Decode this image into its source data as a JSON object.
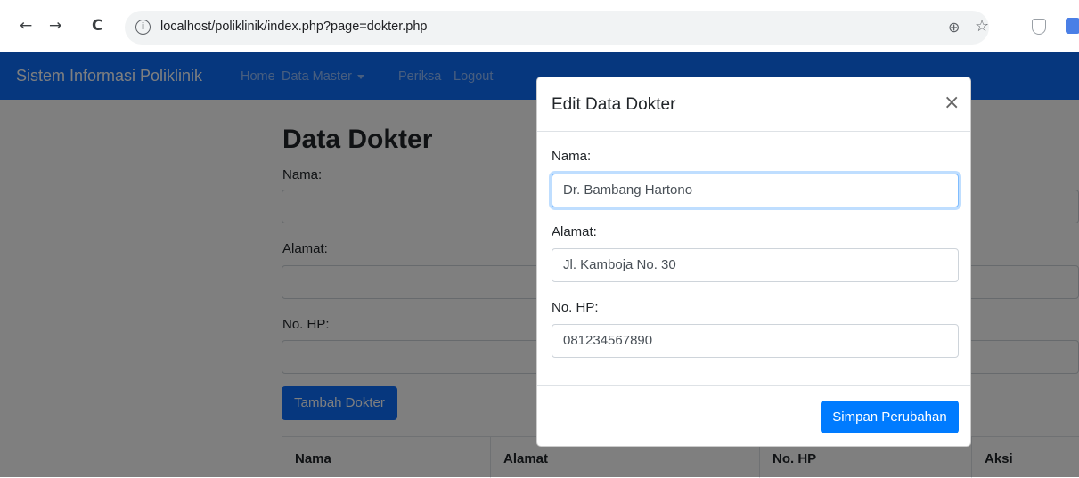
{
  "browser": {
    "back_glyph": "←",
    "forward_glyph": "→",
    "reload_glyph": "C",
    "info_glyph": "i",
    "url": "localhost/poliklinik/index.php?page=dokter.php",
    "zoom_glyph": "⊕",
    "star_glyph": "☆"
  },
  "navbar": {
    "brand": "Sistem Informasi Poliklinik",
    "links": [
      "Home",
      "Data Master",
      "Periksa",
      "Logout"
    ]
  },
  "page": {
    "title": "Data Dokter",
    "fields": [
      {
        "label": "Nama:",
        "value": ""
      },
      {
        "label": "Alamat:",
        "value": ""
      },
      {
        "label": "No. HP:",
        "value": ""
      }
    ],
    "add_button": "Tambah Dokter",
    "table": {
      "headers": [
        "Nama",
        "Alamat",
        "No. HP",
        "Aksi"
      ]
    }
  },
  "modal": {
    "title": "Edit Data Dokter",
    "close_glyph": "×",
    "fields": [
      {
        "label": "Nama:",
        "value": "Dr. Bambang Hartono"
      },
      {
        "label": "Alamat:",
        "value": "Jl. Kamboja No. 30"
      },
      {
        "label": "No. HP:",
        "value": "081234567890"
      }
    ],
    "save_button": "Simpan Perubahan"
  },
  "colors": {
    "primary": "#0d6efd",
    "modal_button": "#007bff",
    "backdrop": "rgba(0,0,0,0.5)"
  }
}
